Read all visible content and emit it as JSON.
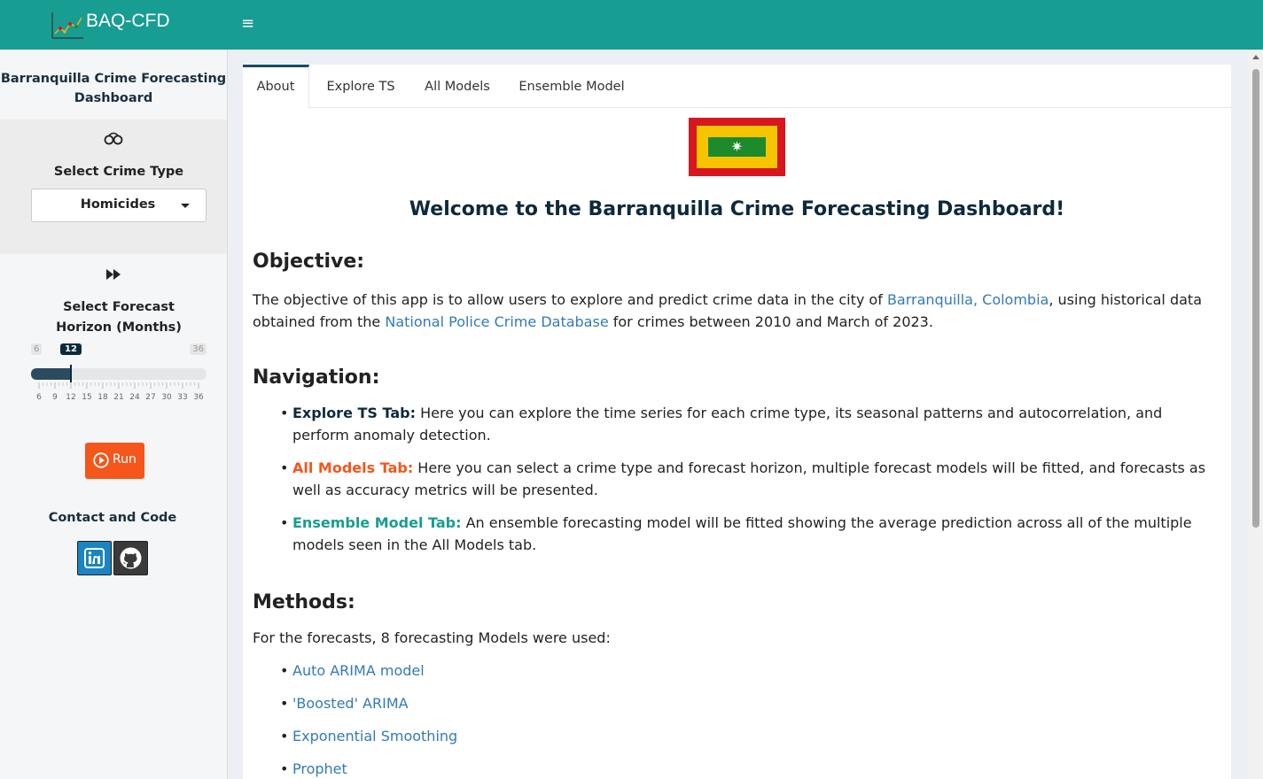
{
  "header": {
    "app_title": "BAQ-CFD",
    "menu_icon": "hamburger-icon"
  },
  "sidebar": {
    "title": "Barranquilla Crime Forecasting Dashboard",
    "crime_icon": "handcuffs-icon",
    "crime_label": "Select Crime Type",
    "crime_selected": "Homicides",
    "horizon_icon": "fast-forward-icon",
    "horizon_label": "Select Forecast Horizon (Months)",
    "slider": {
      "min": "6",
      "max": "36",
      "value": "12",
      "grid": [
        "6",
        "9",
        "12",
        "15",
        "18",
        "21",
        "24",
        "27",
        "30",
        "33",
        "36"
      ]
    },
    "run_label": "Run",
    "contact_label": "Contact and Code",
    "linkedin_icon": "linkedin-icon",
    "github_icon": "github-icon"
  },
  "tabs": [
    "About",
    "Explore TS",
    "All Models",
    "Ensemble Model"
  ],
  "about": {
    "welcome": "Welcome to the Barranquilla Crime Forecasting Dashboard!",
    "objective_heading": "Objective:",
    "objective_p1": "The objective of this app is to allow users to explore and predict crime data in the city of ",
    "objective_link1": "Barranquilla, Colombia",
    "objective_p2": ", using historical data obtained from the ",
    "objective_link2": "National Police Crime Database",
    "objective_p3": " for crimes between 2010 and March of 2023.",
    "navigation_heading": "Navigation:",
    "nav_items": [
      {
        "label": "Explore TS Tab:",
        "text": " Here you can explore the time series for each crime type, its seasonal patterns and autocorrelation, and perform anomaly detection."
      },
      {
        "label": "All Models Tab:",
        "text": " Here you can select a crime type and forecast horizon, multiple forecast models will be fitted, and forecasts as well as accuracy metrics will be presented."
      },
      {
        "label": "Ensemble Model Tab:",
        "text": " An ensemble forecasting model will be fitted showing the average prediction across all of the multiple models seen in the All Models tab."
      }
    ],
    "methods_heading": "Methods:",
    "methods_intro": "For the forecasts, 8 forecasting Models were used:",
    "methods": [
      "Auto ARIMA model",
      "'Boosted' ARIMA",
      "Exponential Smoothing",
      "Prophet"
    ]
  }
}
